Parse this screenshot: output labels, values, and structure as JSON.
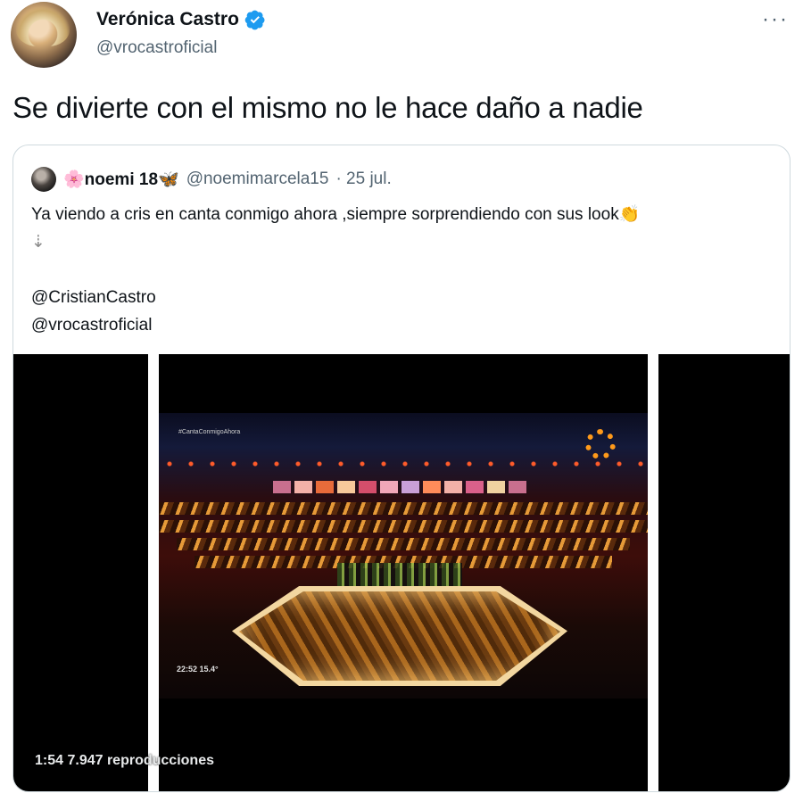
{
  "author": {
    "name": "Verónica Castro",
    "handle": "@vrocastroficial"
  },
  "more_label": "···",
  "tweet_text": "Se divierte con el mismo no le hace daño a nadie",
  "quoted": {
    "name": "🌸noemi 18🦋",
    "handle": "@noemimarcela15",
    "date": "· 25 jul.",
    "line1": "Ya viendo a cris en canta conmigo ahora ,siempre sorprendiendo con sus look👏",
    "line2": "⇣",
    "mention1": "@CristianCastro",
    "mention2": "@vrocastroficial"
  },
  "video": {
    "counter": "1:54   7.947 reproducciones",
    "osd": "22:52   15.4°",
    "hashtag": "#CantaConmigoAhora"
  },
  "colors": {
    "verified": "#1d9bf0",
    "secondary_text": "#536471",
    "border": "#cfd9de"
  }
}
